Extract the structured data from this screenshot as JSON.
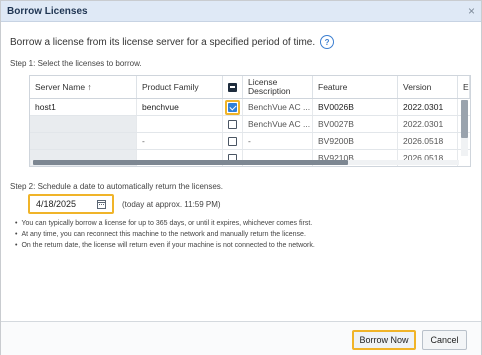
{
  "dialog": {
    "title": "Borrow Licenses",
    "close_glyph": "×",
    "intro": "Borrow a license from its license server for a specified period of time.",
    "help_glyph": "?"
  },
  "step1": {
    "label": "Step 1: Select the licenses to borrow."
  },
  "table": {
    "headers": {
      "server": "Server Name ↑",
      "product": "Product Family",
      "description": "License Description",
      "feature": "Feature",
      "version": "Version",
      "extra": "E"
    },
    "rows": [
      {
        "server": "host1",
        "product": "benchvue",
        "checked": true,
        "description": "BenchVue AC ...",
        "feature": "BV0026B",
        "version": "2022.0301"
      },
      {
        "server": "",
        "product": "",
        "checked": false,
        "description": "BenchVue AC ...",
        "feature": "BV0027B",
        "version": "2022.0301"
      },
      {
        "server": "",
        "product": "-",
        "checked": false,
        "description": "-",
        "feature": "BV9200B",
        "version": "2026.0518"
      },
      {
        "server": "",
        "product": "",
        "checked": false,
        "description": "",
        "feature": "BV9210B",
        "version": "2026.0518"
      }
    ]
  },
  "step2": {
    "label": "Step 2: Schedule a date to automatically return the licenses.",
    "date_value": "4/18/2025",
    "note": "(today at approx. 11:59 PM)",
    "bullets": [
      "You can typically borrow a license for up to 365 days, or until it expires, whichever comes first.",
      "At any time, you can reconnect this machine to the network and manually return the license.",
      "On the return date, the license will return even if your machine is not connected to the network."
    ]
  },
  "footer": {
    "borrow_label": "Borrow Now",
    "cancel_label": "Cancel"
  },
  "colors": {
    "focus_outline": "#f0b429",
    "checkbox_accent": "#2f7fd9",
    "title_bar": "#dfe9f6"
  },
  "icons": {
    "close": "close-icon",
    "help": "help-icon",
    "calendar": "calendar-icon",
    "sort": "sort-ascending-icon"
  }
}
